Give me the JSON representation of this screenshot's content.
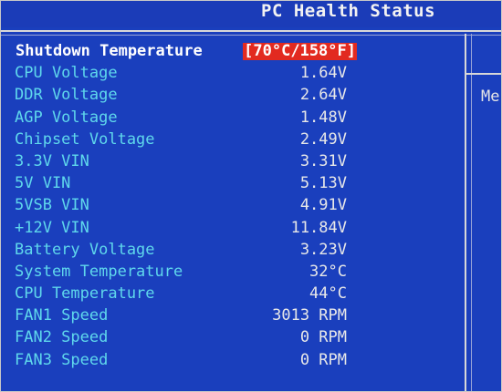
{
  "header": {
    "title": "PC Health Status"
  },
  "side_panel": {
    "text": "Me"
  },
  "items": [
    {
      "label": "Shutdown Temperature",
      "value": "[70°C/158°F]"
    },
    {
      "label": "CPU Voltage",
      "value": "1.64V"
    },
    {
      "label": "DDR Voltage",
      "value": "2.64V"
    },
    {
      "label": "AGP Voltage",
      "value": "1.48V"
    },
    {
      "label": "Chipset Voltage",
      "value": "2.49V"
    },
    {
      "label": "3.3V VIN",
      "value": "3.31V"
    },
    {
      "label": "5V VIN",
      "value": "5.13V"
    },
    {
      "label": "5VSB VIN",
      "value": "4.91V"
    },
    {
      "label": "+12V VIN",
      "value": "11.84V"
    },
    {
      "label": "Battery Voltage",
      "value": "3.23V"
    },
    {
      "label": "System Temperature",
      "value": "32°C"
    },
    {
      "label": "CPU Temperature",
      "value": "44°C"
    },
    {
      "label": "FAN1 Speed",
      "value": "3013 RPM"
    },
    {
      "label": "FAN2 Speed",
      "value": "0 RPM"
    },
    {
      "label": "FAN3 Speed",
      "value": "0 RPM"
    }
  ],
  "colors": {
    "background": "#1a3fbd",
    "label": "#5fd8ec",
    "value": "#e8e8e8",
    "selection": "#e22a20"
  }
}
